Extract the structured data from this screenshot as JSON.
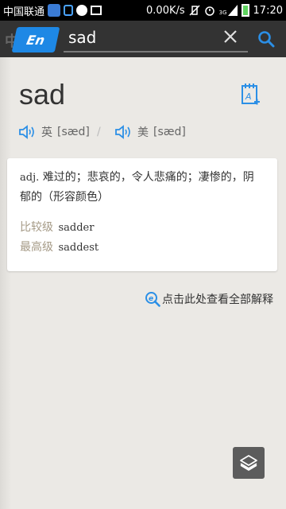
{
  "status_bar": {
    "carrier": "中国联通",
    "net_speed": "0.00K/s",
    "signal_label": "3G",
    "time": "17:20"
  },
  "search": {
    "dict_zh": "中",
    "dict_en": "En",
    "query": "sad"
  },
  "entry": {
    "word": "sad",
    "pronunciations": [
      {
        "region": "英",
        "ipa": "[sæd]"
      },
      {
        "region": "美",
        "ipa": "[sæd]"
      }
    ],
    "separator": "/",
    "definition": {
      "pos": "adj.",
      "meaning": "难过的；悲哀的，令人悲痛的；凄惨的，阴郁的（形容颜色）"
    },
    "forms": [
      {
        "label": "比较级",
        "value": "sadder"
      },
      {
        "label": "最高级",
        "value": "saddest"
      }
    ]
  },
  "more_link": "点击此处查看全部解释",
  "icons": {
    "wordbook": "add-to-wordbook-icon",
    "speaker": "speaker-icon",
    "search": "search-icon",
    "clear": "close-icon",
    "layers": "layers-icon"
  },
  "colors": {
    "accent": "#1e88e5",
    "header_bg": "#333333",
    "page_bg": "#ebe9e5",
    "form_label": "#a59a86"
  }
}
